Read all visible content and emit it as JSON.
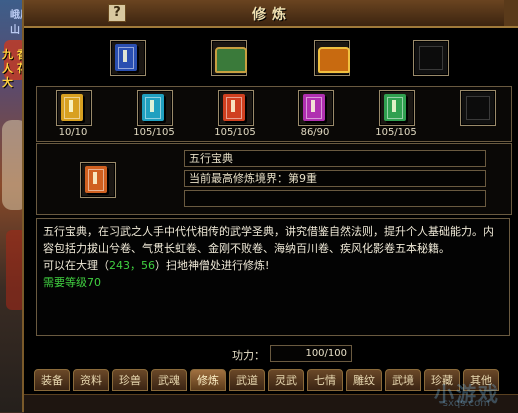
{
  "world": {
    "top_text": "峨眉山",
    "side_text": "九 香 人 花 大"
  },
  "window": {
    "title": "修炼",
    "help_label": "?"
  },
  "top_row": [
    {
      "icon": "book-blue-icon",
      "color": "#2a4fb0"
    },
    {
      "icon": "treasure-chest-green-icon",
      "color": "#3a7a3a"
    },
    {
      "icon": "treasure-chest-orange-icon",
      "color": "#c86a10"
    },
    {
      "icon": "empty-slot-icon",
      "color": "#101010"
    }
  ],
  "skill_books": [
    {
      "count": "10/10",
      "color": "#d8a020"
    },
    {
      "count": "105/105",
      "color": "#20a0c0"
    },
    {
      "count": "105/105",
      "color": "#d04020"
    },
    {
      "count": "86/90",
      "color": "#b030b0"
    },
    {
      "count": "105/105",
      "color": "#30a050"
    },
    {
      "count": "",
      "color": "#101010"
    }
  ],
  "selected": {
    "color": "#d06020",
    "name": "五行宝典",
    "realm_label": "当前最高修炼境界：第9重",
    "blank": ""
  },
  "description": {
    "main": "五行宝典，在习武之人手中代代相传的武学圣典，讲究借鉴自然法则，提升个人基础能力。内容包括力拔山兮卷、气贯长虹卷、金刚不败卷、海纳百川卷、疾风化影卷五本秘籍。",
    "loc_prefix": "可以在大理（",
    "coord": "243，56",
    "loc_suffix": "）扫地神僧处进行修炼!",
    "requirement": "需要等级70"
  },
  "power": {
    "label": "功力：",
    "value": "100/100"
  },
  "tabs": [
    "装备",
    "资料",
    "珍兽",
    "武魂",
    "修炼",
    "武道",
    "灵武",
    "七情",
    "雕纹",
    "武境",
    "珍藏",
    "其他"
  ],
  "active_tab": "修炼",
  "watermark": {
    "main": "小游戏",
    "sub": "sxqs.com"
  }
}
